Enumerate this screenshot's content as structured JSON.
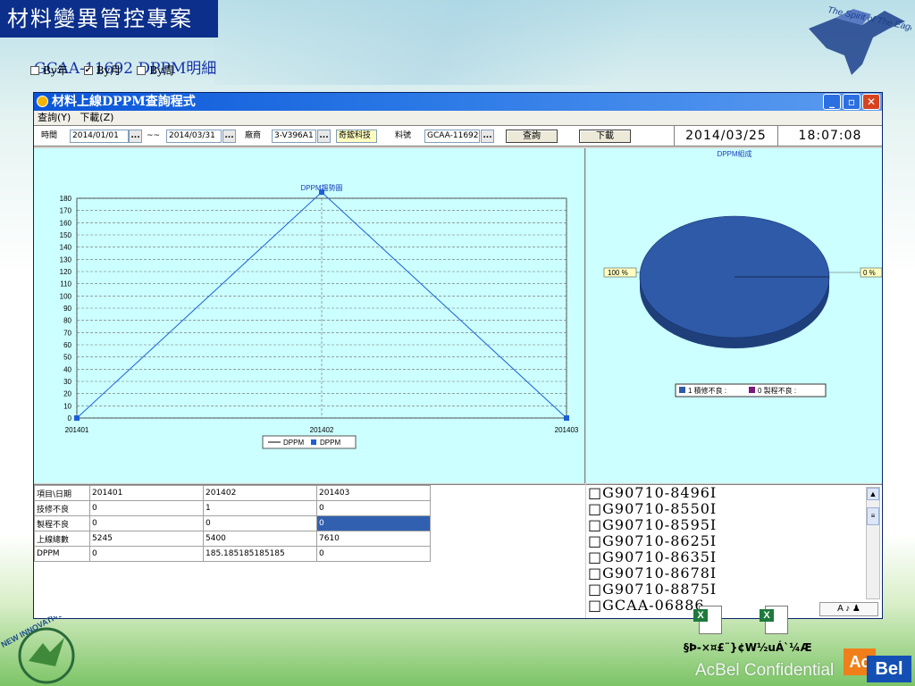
{
  "slide": {
    "title": "材料變異管控專案",
    "subtitle": "GCAA-11692 DPPM明細",
    "logo_text": "The Spirit of The Eagle",
    "corner_logo_text": "NEW INNOVATIVE",
    "garbled_footer": "§Þ-×¤£¨}¢W½uÁ`¼Æ",
    "confidential": "AcBel Confidential",
    "brand_ac": "Ac",
    "brand_bel": "Bel"
  },
  "window": {
    "title": "材料上線DPPM查詢程式",
    "controls": {
      "minimize": "_",
      "maximize": "▫",
      "close": "✕"
    },
    "menu": [
      "查詢(Y)",
      "下載(Z)"
    ]
  },
  "toolbar": {
    "time_label": "時間",
    "start_date": "2014/01/01",
    "separator": "~~",
    "end_date": "2014/03/31",
    "vendor_label": "廠商",
    "vendor_code": "3-V396A1",
    "vendor_name": "奇鋐科技",
    "part_label": "料號",
    "part_no": "GCAA-11692",
    "dots": "...",
    "query_button": "查詢",
    "download_button": "下載",
    "date": "2014/03/25",
    "time": "18:07:08"
  },
  "options": [
    {
      "label": "By年",
      "checked": false,
      "mark": ""
    },
    {
      "label": "By月",
      "checked": true,
      "mark": "✔"
    },
    {
      "label": "By周",
      "checked": false,
      "mark": ""
    }
  ],
  "chart_data": [
    {
      "type": "line",
      "title": "DPPM趨勢圖",
      "categories": [
        "201401",
        "201402",
        "201403"
      ],
      "series": [
        {
          "name": "DPPM",
          "values": [
            0,
            185.19,
            0
          ]
        }
      ],
      "legend": [
        "DPPM",
        "DPPM"
      ],
      "ylim": [
        0,
        180
      ],
      "yticks": [
        0,
        10,
        20,
        30,
        40,
        50,
        60,
        70,
        80,
        90,
        100,
        110,
        120,
        130,
        140,
        150,
        160,
        170,
        180
      ],
      "grid": true,
      "color": "#1a5fd6",
      "legend_position": "bottom"
    },
    {
      "type": "pie",
      "title": "DPPM組成",
      "slices": [
        {
          "label": "1 積修不良 :",
          "value": 1,
          "percent_label": "100 %",
          "color": "#2e5aa8"
        },
        {
          "label": "0 製程不良 :",
          "value": 0,
          "percent_label": "0 %",
          "color": "#7a1a7a"
        }
      ],
      "legend_position": "bottom"
    }
  ],
  "table": {
    "header": [
      "項目\\日期",
      "201401",
      "201402",
      "201403"
    ],
    "rows": [
      [
        "技修不良",
        "0",
        "1",
        "0"
      ],
      [
        "製程不良",
        "0",
        "0",
        "0"
      ],
      [
        "上線總數",
        "5245",
        "5400",
        "7610"
      ],
      [
        "DPPM",
        "0",
        "185.185185185185",
        "0"
      ]
    ]
  },
  "list_items": [
    "G90710-8496I",
    "G90710-8550I",
    "G90710-8595I",
    "G90710-8625I",
    "G90710-8635I",
    "G90710-8678I",
    "G90710-8875I",
    "GCAA-06886"
  ],
  "list_scroll": {
    "up": "▲",
    "thumb": "≡"
  },
  "ime_bar": "A ♪ ♟"
}
